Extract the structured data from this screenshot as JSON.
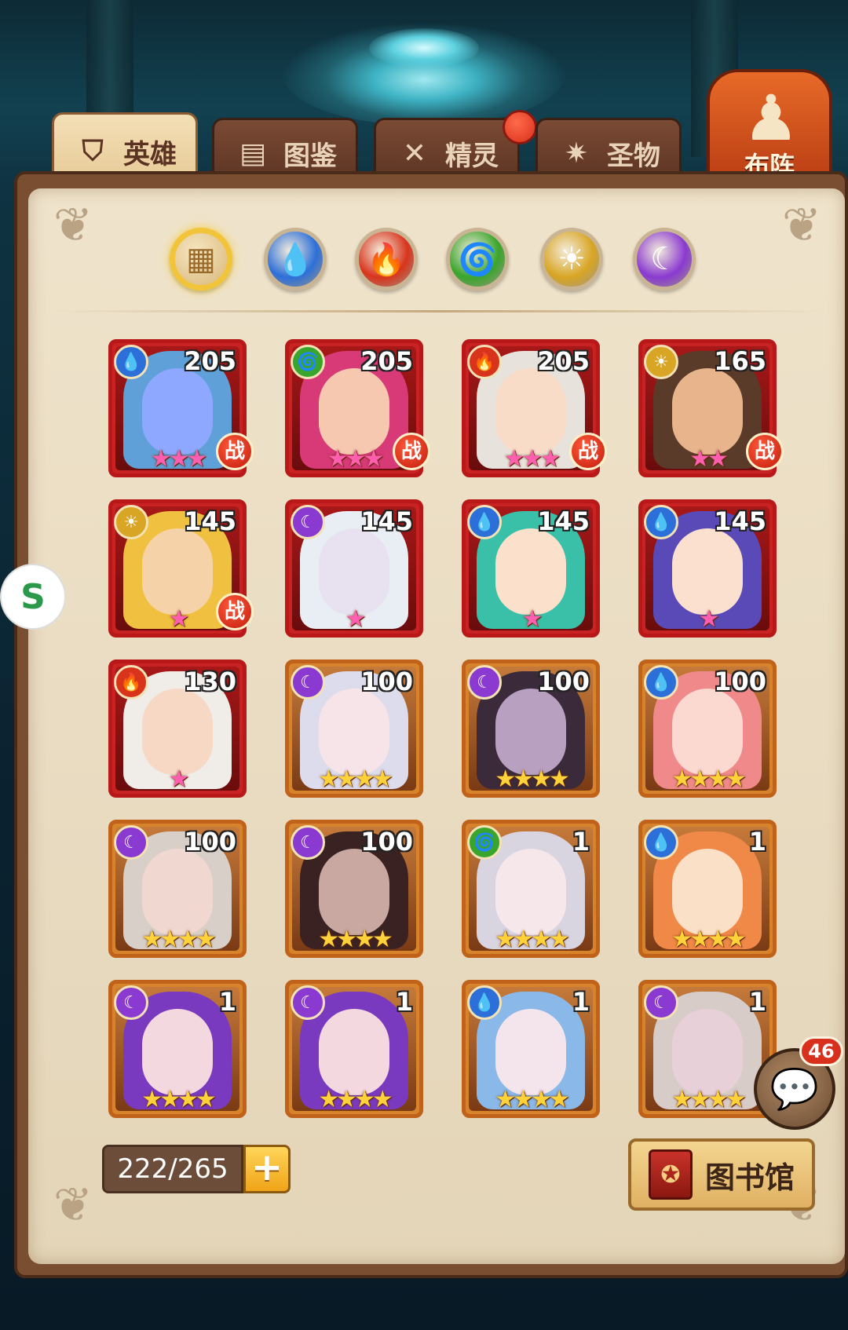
{
  "tabs": [
    {
      "label": "英雄",
      "icon": "helmet-icon",
      "active": true
    },
    {
      "label": "图鉴",
      "icon": "book-icon",
      "active": false
    },
    {
      "label": "精灵",
      "icon": "butterfly-icon",
      "active": false
    },
    {
      "label": "圣物",
      "icon": "compass-icon",
      "active": false
    }
  ],
  "formation": {
    "label": "布阵",
    "icon": "chess-pawn-icon"
  },
  "filters": [
    {
      "name": "all",
      "icon": "grid-icon",
      "color": "#f2c43a",
      "selected": true
    },
    {
      "name": "water",
      "icon": "water-drop-icon",
      "color": "#2d6fd8"
    },
    {
      "name": "fire",
      "icon": "flame-icon",
      "color": "#d8341c"
    },
    {
      "name": "wind",
      "icon": "tornado-icon",
      "color": "#3aa52c"
    },
    {
      "name": "light",
      "icon": "sun-icon",
      "color": "#d8a524"
    },
    {
      "name": "dark",
      "icon": "moon-icon",
      "color": "#8a3ad0"
    }
  ],
  "heroes": [
    {
      "level": "205",
      "element": "water",
      "stars": "★★★",
      "star_color": "pink",
      "frame": "red",
      "battle": "战"
    },
    {
      "level": "205",
      "element": "wind",
      "stars": "★★★",
      "star_color": "pink",
      "frame": "red",
      "battle": "战"
    },
    {
      "level": "205",
      "element": "fire",
      "stars": "★★★",
      "star_color": "pink",
      "frame": "red",
      "battle": "战"
    },
    {
      "level": "165",
      "element": "light",
      "stars": "★★",
      "star_color": "pink",
      "frame": "red",
      "battle": "战"
    },
    {
      "level": "145",
      "element": "light",
      "stars": "★",
      "star_color": "pink",
      "frame": "red",
      "battle": "战"
    },
    {
      "level": "145",
      "element": "dark",
      "stars": "★",
      "star_color": "pink",
      "frame": "red",
      "battle": ""
    },
    {
      "level": "145",
      "element": "water",
      "stars": "★",
      "star_color": "pink",
      "frame": "red",
      "battle": ""
    },
    {
      "level": "145",
      "element": "water",
      "stars": "★",
      "star_color": "pink",
      "frame": "red",
      "battle": ""
    },
    {
      "level": "130",
      "element": "fire",
      "stars": "★",
      "star_color": "pink",
      "frame": "red",
      "battle": ""
    },
    {
      "level": "100",
      "element": "dark",
      "stars": "★★★★",
      "star_color": "gold",
      "frame": "orange",
      "battle": ""
    },
    {
      "level": "100",
      "element": "dark",
      "stars": "★★★★",
      "star_color": "gold",
      "frame": "orange",
      "battle": ""
    },
    {
      "level": "100",
      "element": "water",
      "stars": "★★★★",
      "star_color": "gold",
      "frame": "orange",
      "battle": ""
    },
    {
      "level": "100",
      "element": "dark",
      "stars": "★★★★",
      "star_color": "gold",
      "frame": "orange",
      "battle": ""
    },
    {
      "level": "100",
      "element": "dark",
      "stars": "★★★★",
      "star_color": "gold",
      "frame": "orange",
      "battle": ""
    },
    {
      "level": "1",
      "element": "wind",
      "stars": "★★★★",
      "star_color": "gold",
      "frame": "orange",
      "battle": ""
    },
    {
      "level": "1",
      "element": "water",
      "stars": "★★★★",
      "star_color": "gold",
      "frame": "orange",
      "battle": ""
    },
    {
      "level": "1",
      "element": "dark",
      "stars": "★★★★",
      "star_color": "gold",
      "frame": "orange",
      "battle": ""
    },
    {
      "level": "1",
      "element": "dark",
      "stars": "★★★★",
      "star_color": "gold",
      "frame": "orange",
      "battle": ""
    },
    {
      "level": "1",
      "element": "water",
      "stars": "★★★★",
      "star_color": "gold",
      "frame": "orange",
      "battle": ""
    },
    {
      "level": "1",
      "element": "dark",
      "stars": "★★★★",
      "star_color": "gold",
      "frame": "orange",
      "battle": ""
    }
  ],
  "element_colors": {
    "water": "#2d6fd8",
    "fire": "#d8341c",
    "wind": "#3aa52c",
    "light": "#d8a524",
    "dark": "#8a3ad0"
  },
  "element_glyphs": {
    "water": "💧",
    "fire": "🔥",
    "wind": "🌀",
    "light": "☀",
    "dark": "☾"
  },
  "capacity": {
    "text": "222/265",
    "plus": "+"
  },
  "library_button": {
    "label": "图书馆",
    "icon": "spellbook-icon"
  },
  "chat": {
    "badge": "46",
    "icon": "chat-bubble-icon"
  },
  "side_logo": {
    "icon": "app-logo-icon",
    "glyph": "S"
  }
}
